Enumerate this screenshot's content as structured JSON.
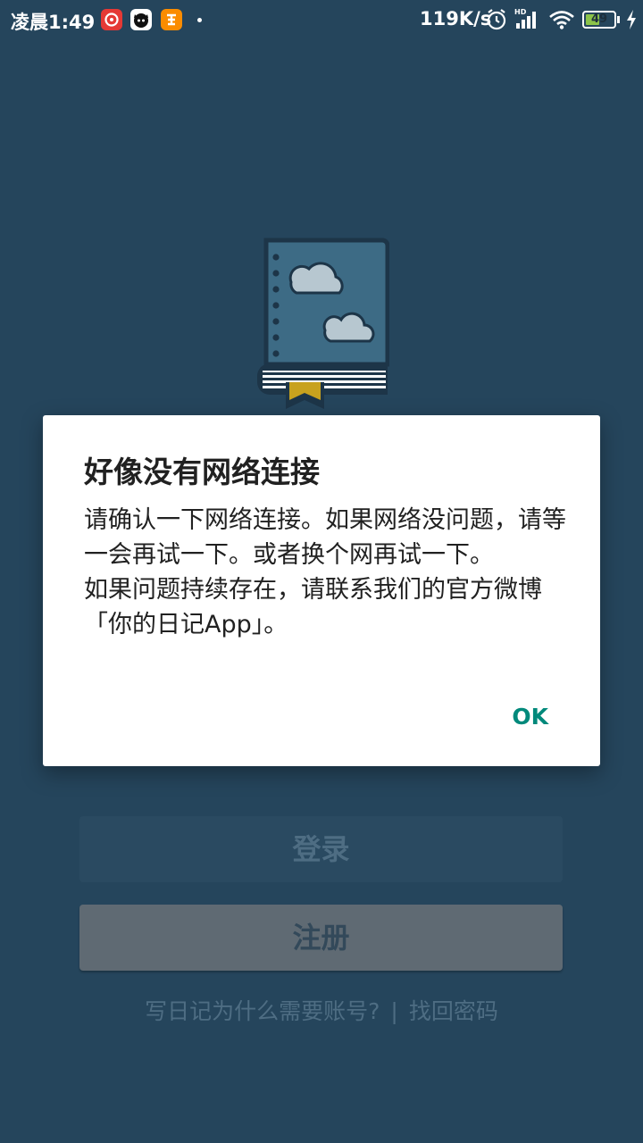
{
  "status_bar": {
    "time": "凌晨1:49",
    "net_speed": "119K/s",
    "battery": "49",
    "battery_level": 0.49,
    "hd_label": "HD"
  },
  "dialog": {
    "title": "好像没有网络连接",
    "message_line1": "请确认一下网络连接。如果网络没问题，请等一会再试一下。或者换个网再试一下。",
    "message_line2": "如果问题持续存在，请联系我们的官方微博「你的日记App」。",
    "ok_label": "OK"
  },
  "buttons": {
    "login_label": "登录",
    "register_label": "注册"
  },
  "links": {
    "why_account": "写日记为什么需要账号?",
    "separator": "|",
    "forgot_password": "找回密码"
  },
  "colors": {
    "background": "#25455c",
    "accent": "#00897b"
  }
}
